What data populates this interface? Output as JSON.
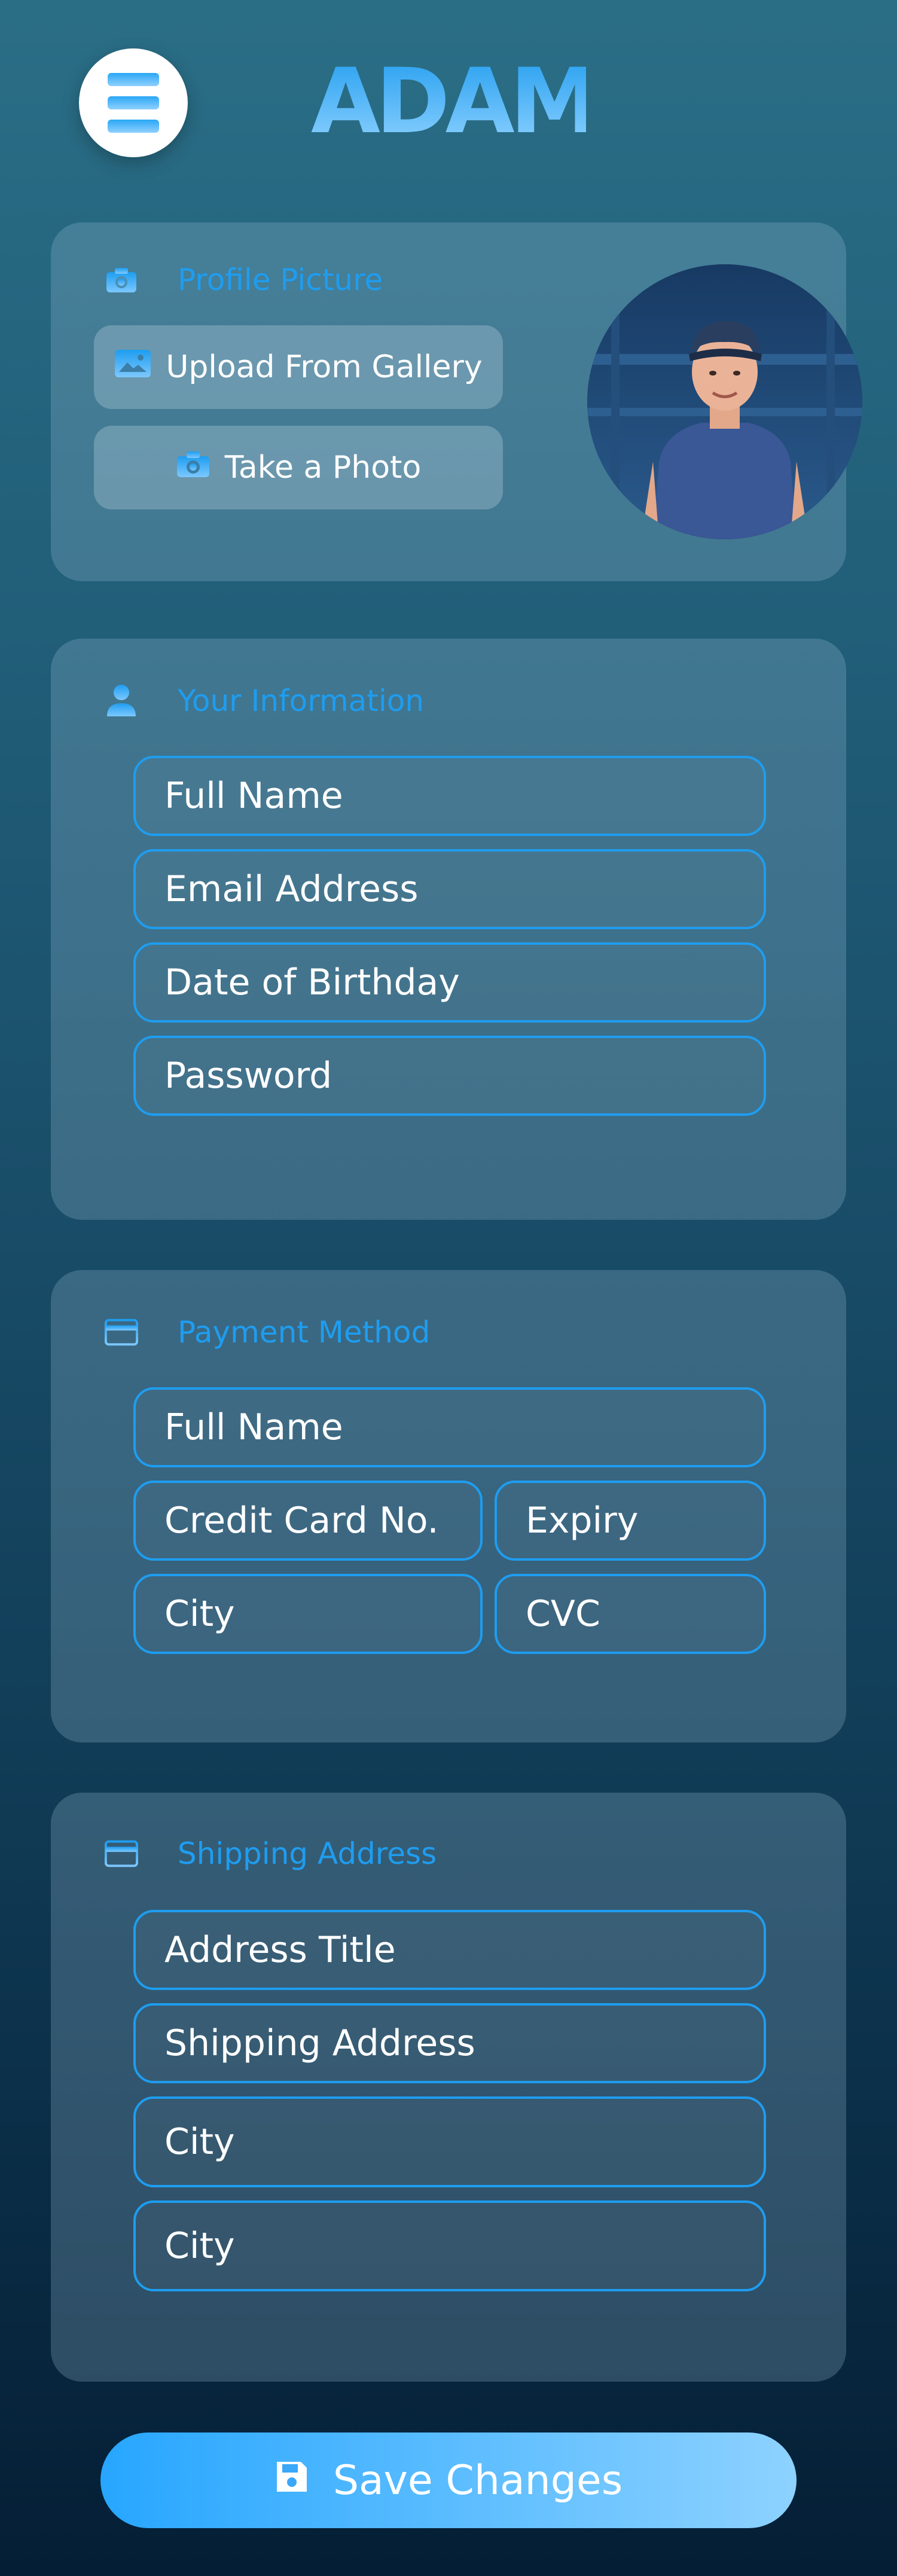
{
  "app": {
    "logo_text": "ADAM"
  },
  "header": {
    "menu_icon": "hamburger-menu-icon"
  },
  "profile_picture": {
    "title": "Profile Picture",
    "icon": "camera-icon",
    "upload_label": "Upload From Gallery",
    "upload_icon": "image-icon",
    "photo_label": "Take a Photo",
    "photo_icon": "camera-icon"
  },
  "your_information": {
    "title": "Your Information",
    "icon": "user-icon",
    "fields": [
      "Full Name",
      "Email Address",
      "Date of Birthday",
      "Password"
    ]
  },
  "payment_method": {
    "title": "Payment Method",
    "icon": "credit-card-icon",
    "fields": [
      "Full Name",
      "Credit Card No.",
      "Expiry",
      "City",
      "CVC"
    ]
  },
  "shipping_address": {
    "title": "Shipping Address",
    "icon": "credit-card-icon",
    "fields": [
      "Address Title",
      "Shipping Address",
      "City",
      "City"
    ]
  },
  "save_button": {
    "label": "Save Changes",
    "icon": "floppy-disk-icon"
  },
  "colors": {
    "accent": "#1e9df0",
    "button_gradient_start": "#27a6ff",
    "button_gradient_end": "#8dd2ff",
    "background_top": "#2a6e86",
    "background_bottom": "#041e35"
  }
}
